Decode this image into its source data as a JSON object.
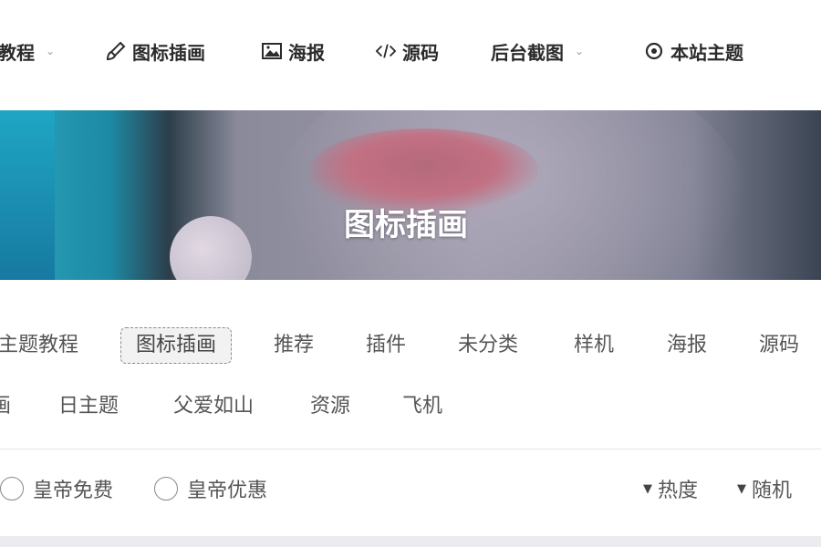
{
  "nav": {
    "items": [
      {
        "label": "教程",
        "icon": "none",
        "dropdown": true
      },
      {
        "label": "图标插画",
        "icon": "brush-icon",
        "dropdown": false
      },
      {
        "label": "海报",
        "icon": "image-icon",
        "dropdown": false
      },
      {
        "label": "源码",
        "icon": "code-icon",
        "dropdown": false
      },
      {
        "label": "后台截图",
        "icon": "none",
        "dropdown": true
      },
      {
        "label": "本站主题",
        "icon": "target-icon",
        "dropdown": false
      }
    ],
    "chevron": "⌄"
  },
  "banner": {
    "title": "图标插画"
  },
  "categories": {
    "row1": [
      "主题教程",
      "图标插画",
      "推荐",
      "插件",
      "未分类",
      "样机",
      "海报",
      "源码"
    ],
    "row2": [
      "画",
      "日主题",
      "父爱如山",
      "资源",
      "飞机"
    ],
    "active": "图标插画"
  },
  "filters": {
    "radios": [
      "皇帝免费",
      "皇帝优惠"
    ],
    "sorts": [
      "热度",
      "随机"
    ]
  },
  "colors": {
    "nav_text": "#2b2b2b",
    "category_text": "#555555",
    "banner_title": "#ffffff"
  }
}
